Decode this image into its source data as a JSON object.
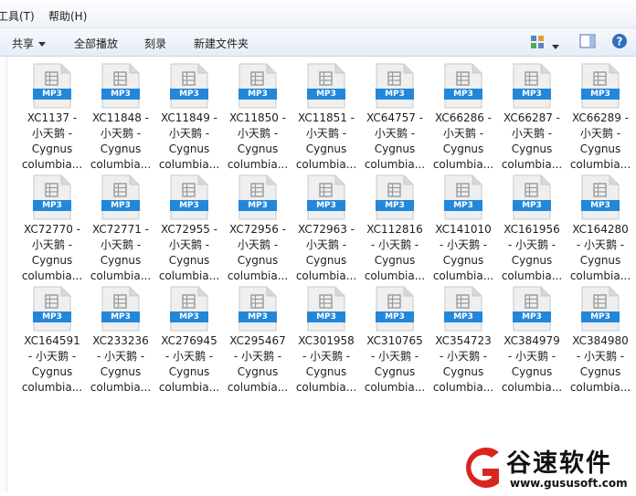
{
  "menu": {
    "tools": "工具(T)",
    "help": "帮助(H)"
  },
  "toolbar": {
    "share": "共享",
    "play_all": "全部播放",
    "burn": "刻录",
    "new_folder": "新建文件夹"
  },
  "files": [
    {
      "line1": "XC1137 -",
      "line2": "小天鹅 -",
      "line3": "Cygnus",
      "line4": "columbia..."
    },
    {
      "line1": "XC11848 -",
      "line2": "小天鹅 -",
      "line3": "Cygnus",
      "line4": "columbia..."
    },
    {
      "line1": "XC11849 -",
      "line2": "小天鹅 -",
      "line3": "Cygnus",
      "line4": "columbia..."
    },
    {
      "line1": "XC11850 -",
      "line2": "小天鹅 -",
      "line3": "Cygnus",
      "line4": "columbia..."
    },
    {
      "line1": "XC11851 -",
      "line2": "小天鹅 -",
      "line3": "Cygnus",
      "line4": "columbia..."
    },
    {
      "line1": "XC64757 -",
      "line2": "小天鹅 -",
      "line3": "Cygnus",
      "line4": "columbia..."
    },
    {
      "line1": "XC66286 -",
      "line2": "小天鹅 -",
      "line3": "Cygnus",
      "line4": "columbia..."
    },
    {
      "line1": "XC66287 -",
      "line2": "小天鹅 -",
      "line3": "Cygnus",
      "line4": "columbia..."
    },
    {
      "line1": "XC66289 -",
      "line2": "小天鹅 -",
      "line3": "Cygnus",
      "line4": "columbia..."
    },
    {
      "line1": "XC72770 -",
      "line2": "小天鹅 -",
      "line3": "Cygnus",
      "line4": "columbia..."
    },
    {
      "line1": "XC72771 -",
      "line2": "小天鹅 -",
      "line3": "Cygnus",
      "line4": "columbia..."
    },
    {
      "line1": "XC72955 -",
      "line2": "小天鹅 -",
      "line3": "Cygnus",
      "line4": "columbia..."
    },
    {
      "line1": "XC72956 -",
      "line2": "小天鹅 -",
      "line3": "Cygnus",
      "line4": "columbia..."
    },
    {
      "line1": "XC72963 -",
      "line2": "小天鹅 -",
      "line3": "Cygnus",
      "line4": "columbia..."
    },
    {
      "line1": "XC112816",
      "line2": "- 小天鹅 -",
      "line3": "Cygnus",
      "line4": "columbia..."
    },
    {
      "line1": "XC141010",
      "line2": "- 小天鹅 -",
      "line3": "Cygnus",
      "line4": "columbia..."
    },
    {
      "line1": "XC161956",
      "line2": "- 小天鹅 -",
      "line3": "Cygnus",
      "line4": "columbia..."
    },
    {
      "line1": "XC164280",
      "line2": "- 小天鹅 -",
      "line3": "Cygnus",
      "line4": "columbia..."
    },
    {
      "line1": "XC164591",
      "line2": "- 小天鹅 -",
      "line3": "Cygnus",
      "line4": "columbia..."
    },
    {
      "line1": "XC233236",
      "line2": "- 小天鹅 -",
      "line3": "Cygnus",
      "line4": "columbia..."
    },
    {
      "line1": "XC276945",
      "line2": "- 小天鹅 -",
      "line3": "Cygnus",
      "line4": "columbia..."
    },
    {
      "line1": "XC295467",
      "line2": "- 小天鹅 -",
      "line3": "Cygnus",
      "line4": "columbia..."
    },
    {
      "line1": "XC301958",
      "line2": "- 小天鹅 -",
      "line3": "Cygnus",
      "line4": "columbia..."
    },
    {
      "line1": "XC310765",
      "line2": "- 小天鹅 -",
      "line3": "Cygnus",
      "line4": "columbia..."
    },
    {
      "line1": "XC354723",
      "line2": "- 小天鹅 -",
      "line3": "Cygnus",
      "line4": "columbia..."
    },
    {
      "line1": "XC384979",
      "line2": "- 小天鹅 -",
      "line3": "Cygnus",
      "line4": "columbia..."
    },
    {
      "line1": "XC384980",
      "line2": "- 小天鹅 -",
      "line3": "Cygnus",
      "line4": "columbia..."
    }
  ],
  "file_badge": "MP3",
  "watermark": {
    "text": "谷速软件",
    "url": "www.gususoft.com"
  },
  "colors": {
    "badge": "#2387d9",
    "watermark_logo": "#d9251d"
  }
}
